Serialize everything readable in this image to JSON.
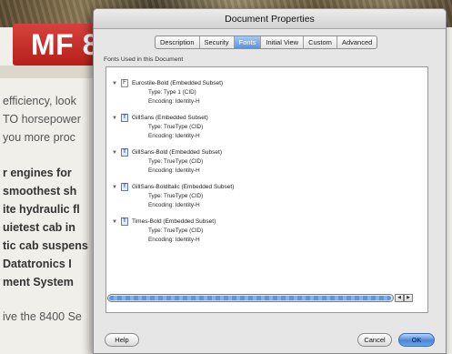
{
  "background": {
    "banner": "MF 8",
    "lines": [
      {
        "text": "efficiency, look",
        "bold": false
      },
      {
        "text": "TO horsepower",
        "bold": false
      },
      {
        "text": "you more proc",
        "bold": false
      },
      {
        "text": "r engines for",
        "bold": true
      },
      {
        "text": "smoothest sh",
        "bold": true
      },
      {
        "text": "ite hydraulic fl",
        "bold": true
      },
      {
        "text": "uietest cab in",
        "bold": true
      },
      {
        "text": "tic cab suspens",
        "bold": true
      },
      {
        "text": "Datatronics I",
        "bold": true
      },
      {
        "text": "ment System",
        "bold": true
      },
      {
        "text": "ive the 8400 Se",
        "bold": false
      }
    ]
  },
  "dialog": {
    "title": "Document Properties",
    "tabs": [
      {
        "label": "Description",
        "active": false
      },
      {
        "label": "Security",
        "active": false
      },
      {
        "label": "Fonts",
        "active": true
      },
      {
        "label": "Initial View",
        "active": false
      },
      {
        "label": "Custom",
        "active": false
      },
      {
        "label": "Advanced",
        "active": false
      }
    ],
    "group_label": "Fonts Used in this Document",
    "fonts": [
      {
        "name": "Eurostile-Bold (Embedded Subset)",
        "icon": "F",
        "icon_type": "type1",
        "type": "Type: Type 1 (CID)",
        "encoding": "Encoding: Identity-H"
      },
      {
        "name": "GillSans (Embedded Subset)",
        "icon": "T",
        "icon_type": "truetype",
        "type": "Type: TrueType (CID)",
        "encoding": "Encoding: Identity-H"
      },
      {
        "name": "GillSans-Bold (Embedded Subset)",
        "icon": "T",
        "icon_type": "truetype",
        "type": "Type: TrueType (CID)",
        "encoding": "Encoding: Identity-H"
      },
      {
        "name": "GillSans-BoldItalic (Embedded Subset)",
        "icon": "T",
        "icon_type": "truetype",
        "type": "Type: TrueType (CID)",
        "encoding": "Encoding: Identity-H"
      },
      {
        "name": "Times-Bold (Embedded Subset)",
        "icon": "T",
        "icon_type": "truetype",
        "type": "Type: TrueType (CID)",
        "encoding": "Encoding: Identity-H"
      }
    ],
    "disclosure_glyph": "▼",
    "scroll_left_glyph": "◀",
    "scroll_right_glyph": "▶",
    "buttons": {
      "help": "Help",
      "cancel": "Cancel",
      "ok": "OK"
    }
  },
  "colors": {
    "accent": "#5d92d8",
    "banner_red": "#c42a26"
  }
}
